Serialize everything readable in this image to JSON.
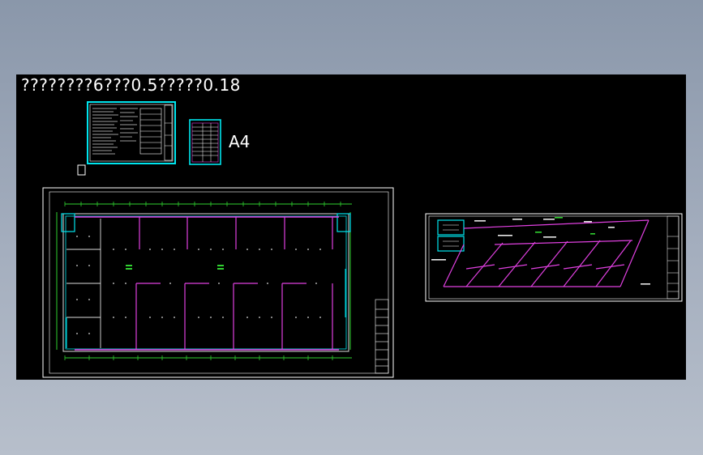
{
  "title_text": "????????6???0.5?????0.18",
  "a4_label": "A4",
  "colors": {
    "background": "#000000",
    "frame": "#ffffff",
    "cyan": "#00e5ee",
    "magenta": "#e040e0",
    "green": "#30d030"
  }
}
